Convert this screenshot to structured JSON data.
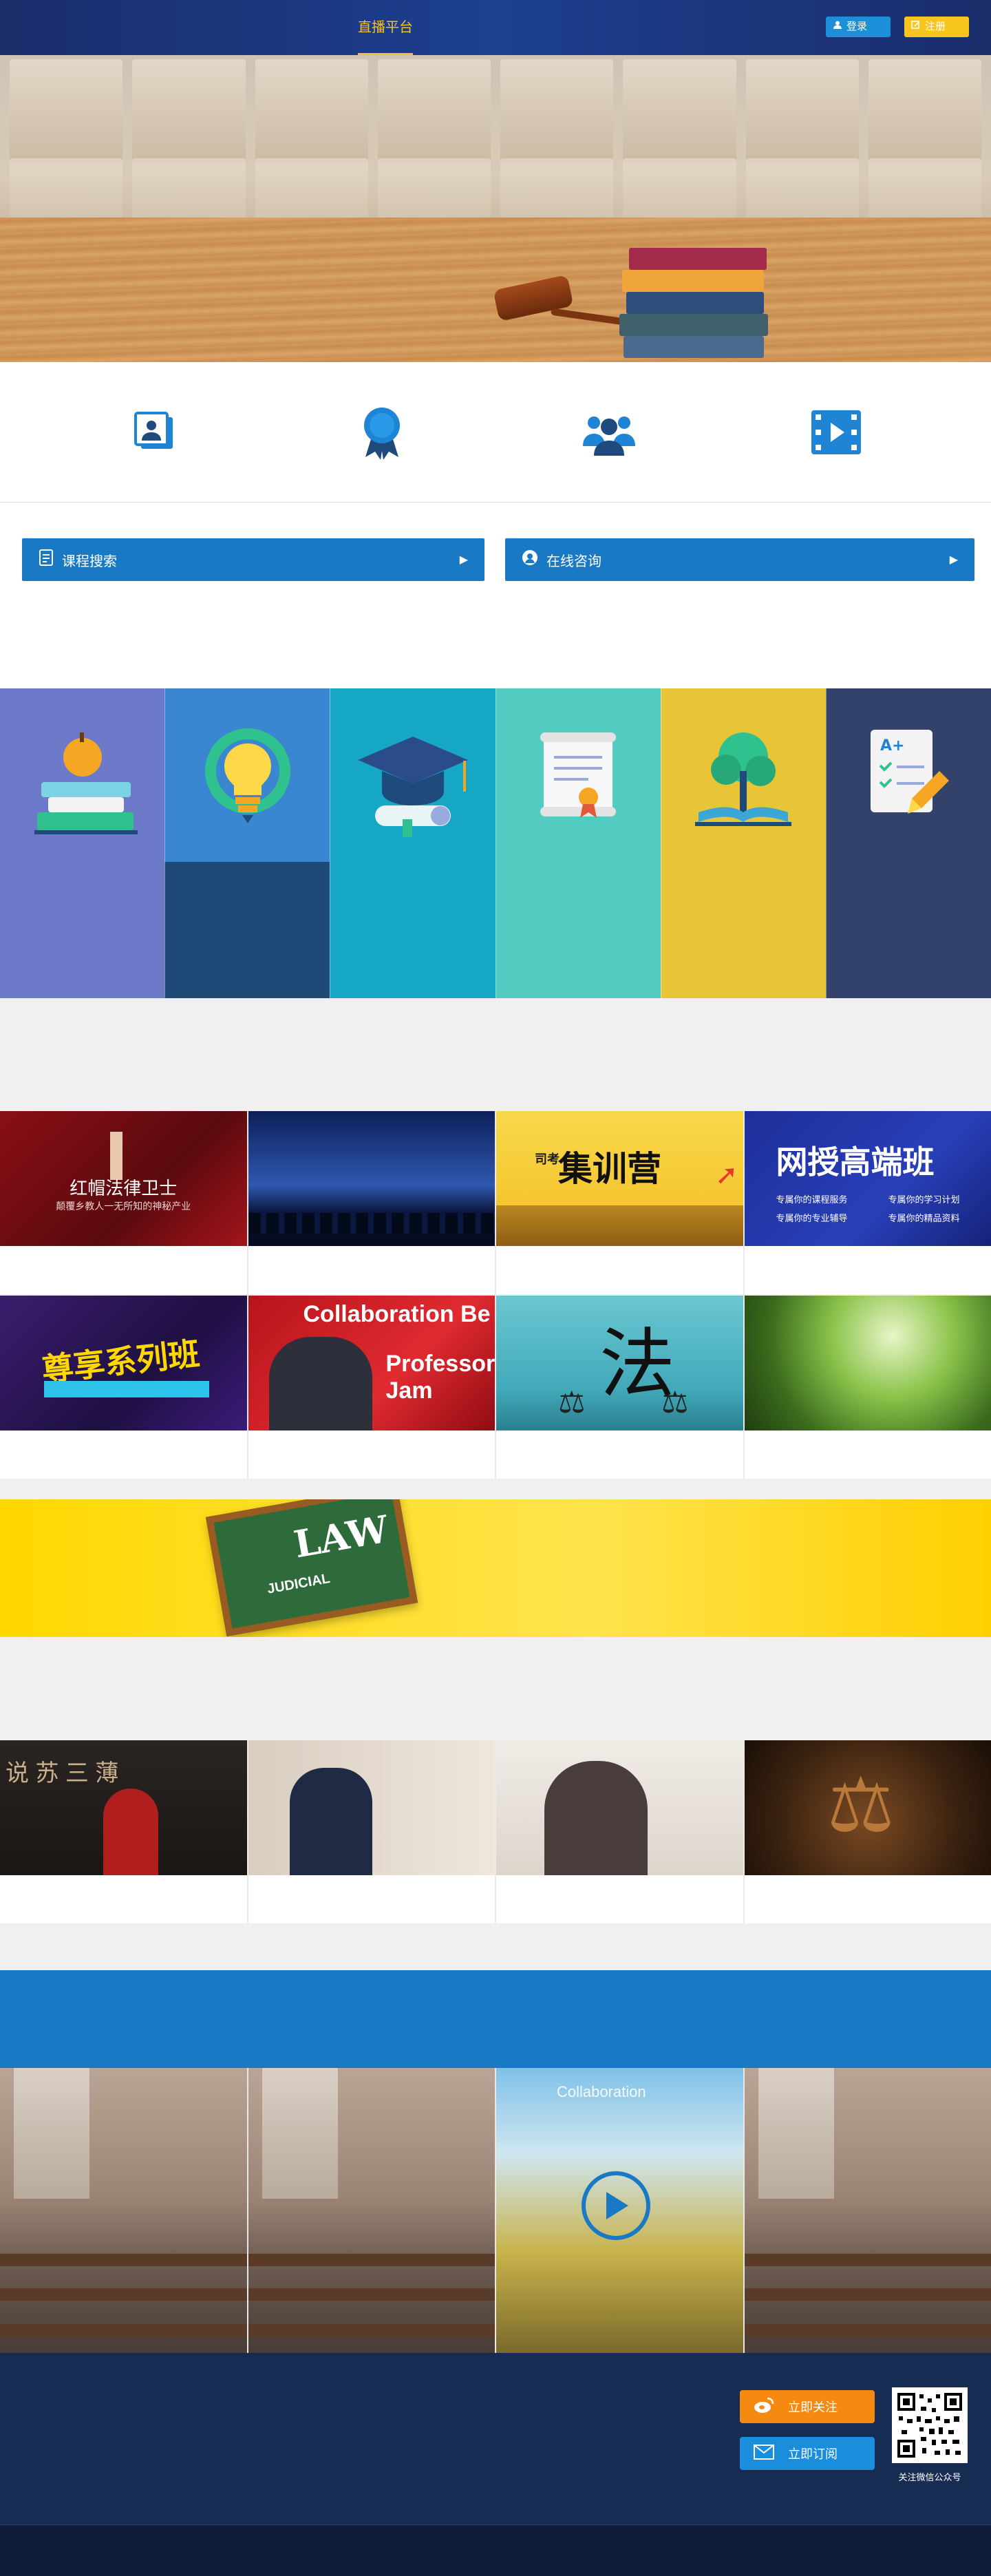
{
  "nav": {
    "link_label": "直播平台",
    "login_label": "登录",
    "register_label": "注册"
  },
  "iconbar": {
    "icons": [
      "profile-card-icon",
      "award-ribbon-icon",
      "group-people-icon",
      "video-film-icon"
    ]
  },
  "search": {
    "course_search_label": "课程搜索",
    "online_consult_label": "在线咨询"
  },
  "tiles": {
    "colors": [
      "#6c79c9",
      "#3a86d0",
      "#16a7c6",
      "#52ccc0",
      "#e8c537",
      "#32426a"
    ],
    "icons": [
      "books-apple-icon",
      "lightbulb-gear-icon",
      "graduation-cap-icon",
      "diploma-scroll-icon",
      "tree-book-icon",
      "grade-checklist-icon"
    ]
  },
  "grid1": {
    "cards": [
      {
        "title": "红帽法律卫士",
        "subtitle": "颠覆乡教人一无所知的神秘产业"
      },
      {
        "title": ""
      },
      {
        "title": "集训营",
        "prefix": "司考"
      },
      {
        "title": "网授高端班",
        "items": [
          "专属你的课程服务",
          "专属你的学习计划",
          "专属你的专业辅导",
          "专属你的精品资料"
        ]
      }
    ]
  },
  "grid2": {
    "cards": [
      {
        "title": "尊享系列班"
      },
      {
        "title": "Collaboration Be",
        "subtitle": "Professor Jam"
      },
      {
        "title": "法"
      },
      {
        "title": ""
      }
    ]
  },
  "banner": {
    "law_label": "LAW",
    "judicial_label": "JUDICIAL"
  },
  "grid3": {
    "cards": [
      {
        "title": "说 苏 三 薄"
      },
      {
        "title": ""
      },
      {
        "title": ""
      },
      {
        "title": ""
      }
    ]
  },
  "classroom": {
    "featured_label": "Collaboration"
  },
  "footer": {
    "follow_label": "立即关注",
    "subscribe_label": "立即订阅",
    "qr_caption": "关注微信公众号"
  }
}
